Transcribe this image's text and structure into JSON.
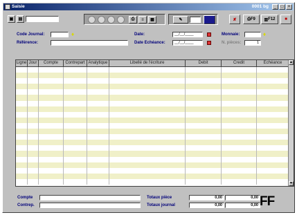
{
  "window": {
    "title": "Saisie",
    "right_title": "0001 bg"
  },
  "toolbar": {
    "f9_label": "F9",
    "f12_label": "F12",
    "cancel_symbol": "✘"
  },
  "header": {
    "code_journal_label": "Code Journal:",
    "reference_label": "Référence:",
    "date_label": "Date:",
    "date_value": "__/__/____",
    "date_echeance_label": "Date Echéance:",
    "date_echeance_value": "__/__/____",
    "monnaie_label": "Monnaie:",
    "n_pieces_label": "N. pièces:",
    "n_pieces_value": "1"
  },
  "grid": {
    "columns": [
      "Ligne",
      "Jour",
      "Compte",
      "Contrepart",
      "Analytique",
      "Libellé de l'écriture",
      "Debit",
      "Credit",
      "Echéance"
    ]
  },
  "footer": {
    "compte_label": "Compte",
    "contrep_label": "Contrep.",
    "totaux_piece_label": "Totaux pièce",
    "totaux_journal_label": "Totaux journal",
    "piece_debit": "0,00",
    "piece_credit": "0,00",
    "journal_debit": "0,00",
    "journal_credit": "0,00",
    "currency": "FF"
  }
}
